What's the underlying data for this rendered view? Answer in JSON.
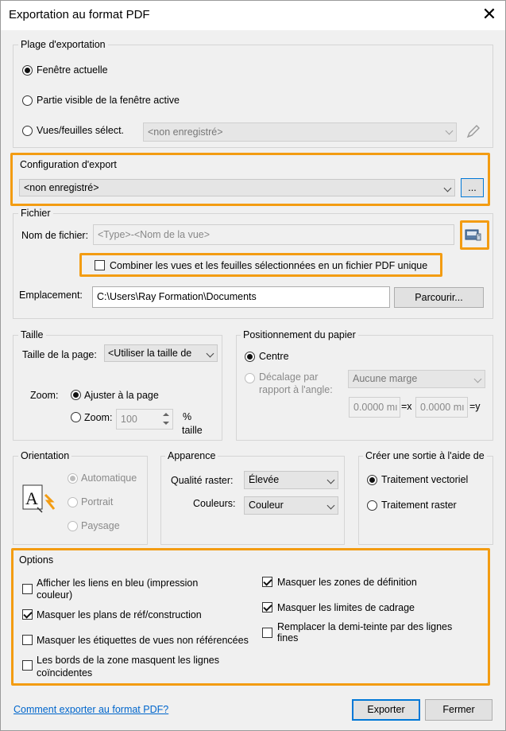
{
  "window": {
    "title": "Exportation au format PDF",
    "close_glyph": "✕"
  },
  "range": {
    "legend": "Plage d'exportation",
    "current_window": "Fenêtre actuelle",
    "visible_part": "Partie visible de la fenêtre active",
    "selected_views": "Vues/feuilles sélect.",
    "selection_value": "<non enregistré>"
  },
  "config": {
    "legend": "Configuration d'export",
    "value": "<non enregistré>",
    "browse_label": "..."
  },
  "file": {
    "legend": "Fichier",
    "name_label": "Nom de fichier:",
    "name_value": "<Type>-<Nom de la vue>",
    "combine_label": "Combiner les vues et les feuilles sélectionnées en un fichier PDF unique",
    "location_label": "Emplacement:",
    "location_value": "C:\\Users\\Ray Formation\\Documents",
    "browse_label": "Parcourir..."
  },
  "size": {
    "legend": "Taille",
    "page_size_label": "Taille de la page:",
    "page_size_value": "<Utiliser la taille de",
    "zoom_label": "Zoom:",
    "fit_page": "Ajuster à la page",
    "zoom_option": "Zoom:",
    "zoom_value": "100",
    "percent": "%",
    "size_word": "taille"
  },
  "paper": {
    "legend": "Positionnement du papier",
    "center": "Centre",
    "offset_line1": "Décalage par",
    "offset_line2": "rapport à l'angle:",
    "margin_value": "Aucune marge",
    "x_value": "0.0000 mı",
    "x_unit": "=x",
    "y_value": "0.0000 mı",
    "y_unit": "=y"
  },
  "orientation": {
    "legend": "Orientation",
    "auto": "Automatique",
    "portrait": "Portrait",
    "landscape": "Paysage"
  },
  "appearance": {
    "legend": "Apparence",
    "raster_label": "Qualité raster:",
    "raster_value": "Élevée",
    "colors_label": "Couleurs:",
    "colors_value": "Couleur"
  },
  "output": {
    "legend": "Créer une sortie à l'aide de",
    "vector": "Traitement vectoriel",
    "raster": "Traitement raster"
  },
  "options": {
    "legend": "Options",
    "links_blue_1": "Afficher les liens en bleu (impression",
    "links_blue_2": "couleur)",
    "hide_ref_planes": "Masquer les plans de réf/construction",
    "hide_unref_tags": "Masquer les étiquettes de vues non référencées",
    "region_edges_1": "Les bords de la zone masquent les lignes",
    "region_edges_2": "coïncidentes",
    "hide_scope_boxes": "Masquer les zones de définition",
    "hide_crop_bounds": "Masquer les limites de cadrage",
    "halftone_1": "Remplacer la demi-teinte par des lignes",
    "halftone_2": "fines"
  },
  "footer": {
    "help_link": "Comment exporter au format PDF?",
    "export_label": "Exporter",
    "close_label": "Fermer"
  },
  "colors": {
    "highlight": "#f39c12",
    "link": "#0066cc",
    "focus": "#0078d7"
  },
  "icons": {
    "pencil": "pencil-icon",
    "file_browse": "folder-browse-icon",
    "orientation": "text-orientation-icon"
  }
}
